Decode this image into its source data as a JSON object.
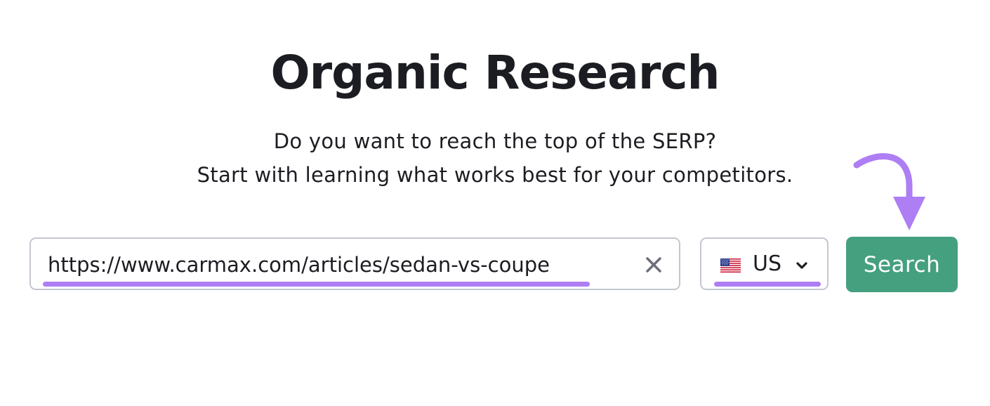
{
  "header": {
    "title": "Organic Research",
    "subtitle_line1": "Do you want to reach the top of the SERP?",
    "subtitle_line2": "Start with learning what works best for your competitors."
  },
  "search": {
    "value": "https://www.carmax.com/articles/sedan-vs-coupe",
    "clear_icon": "close-icon"
  },
  "country": {
    "flag_icon": "us-flag-icon",
    "label": "US",
    "chevron_icon": "chevron-down-icon"
  },
  "actions": {
    "search_label": "Search"
  },
  "colors": {
    "accent_underline": "#ae7ef4",
    "button_green": "#45a080",
    "border": "#c4c7cf",
    "text": "#1c1d22"
  }
}
